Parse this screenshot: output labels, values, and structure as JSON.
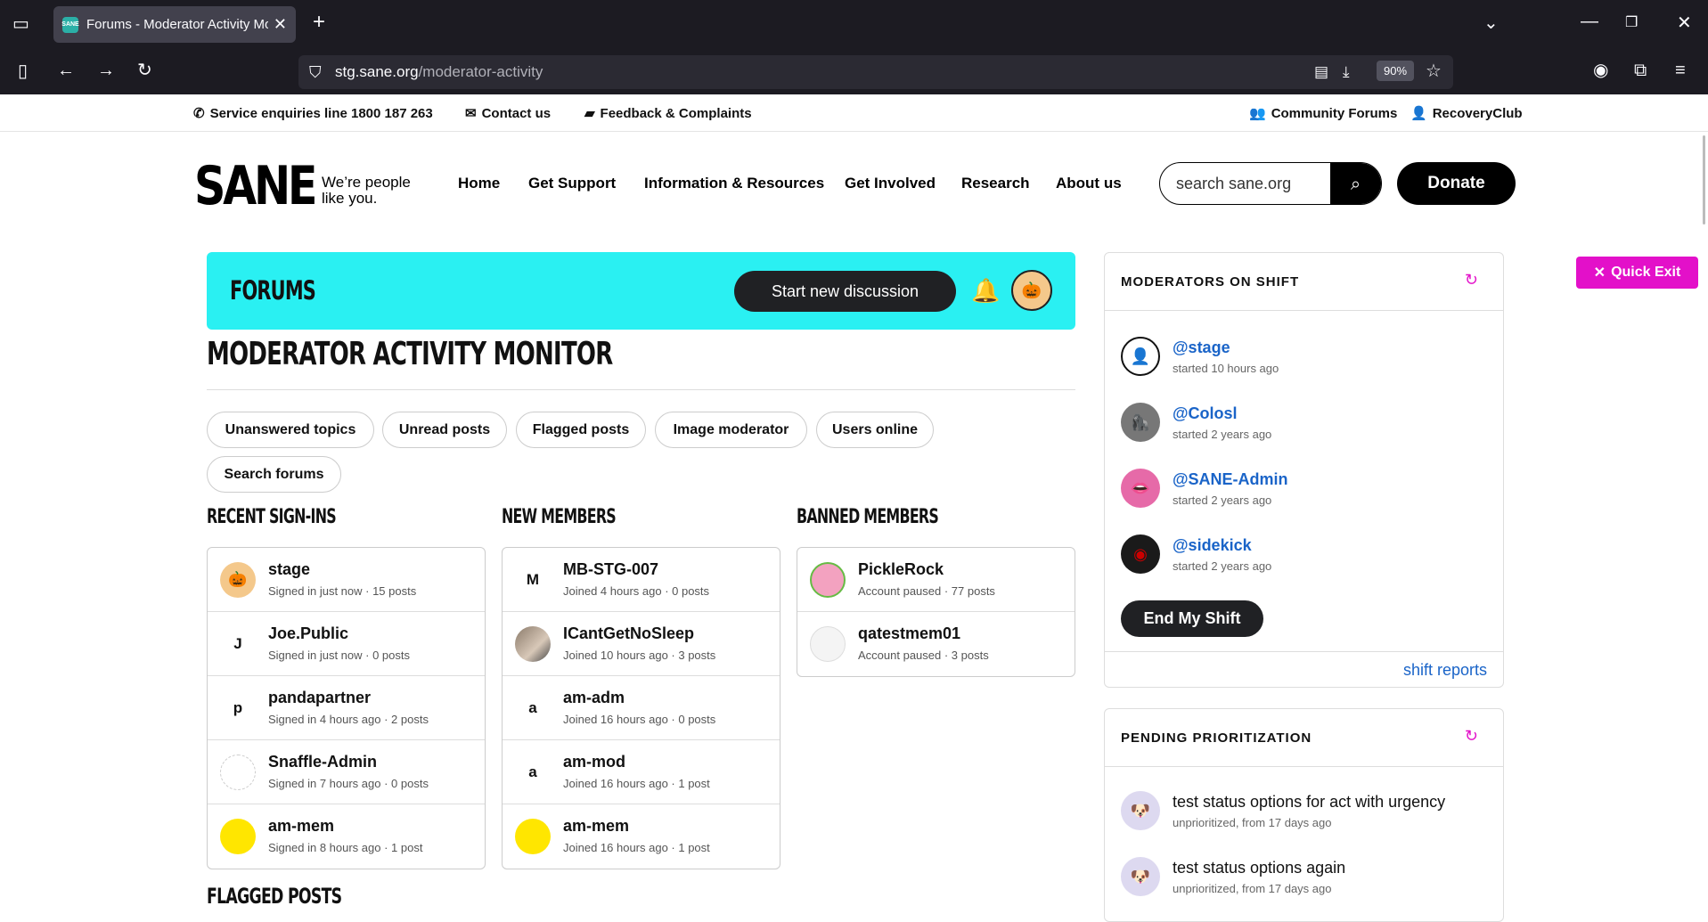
{
  "browser": {
    "tab_title": "Forums - Moderator Activity Mo",
    "tab_favicon": "SANE",
    "url_host": "stg.sane.org",
    "url_path": "/moderator-activity",
    "zoom": "90%"
  },
  "utility_bar": {
    "service": "Service enquiries line 1800 187 263",
    "contact": "Contact us",
    "feedback": "Feedback & Complaints",
    "community": "Community Forums",
    "recovery": "RecoveryClub"
  },
  "header": {
    "logo": "SANE",
    "tagline_1": "We’re people",
    "tagline_2": "like you.",
    "nav": [
      "Home",
      "Get Support",
      "Information & Resources",
      "Get Involved",
      "Research",
      "About us"
    ],
    "search_placeholder": "search sane.org",
    "donate": "Donate"
  },
  "quick_exit": "Quick Exit",
  "banner": {
    "title": "FORUMS",
    "start_discussion": "Start new discussion"
  },
  "page_title": "MODERATOR ACTIVITY MONITOR",
  "filters": [
    "Unanswered topics",
    "Unread posts",
    "Flagged posts",
    "Image moderator",
    "Users online",
    "Search forums"
  ],
  "recent_signins": {
    "heading": "RECENT SIGN-INS",
    "items": [
      {
        "avatar": "🎃",
        "name": "stage",
        "detail": "Signed in just now · 15 posts"
      },
      {
        "avatar": "J",
        "name": "Joe.Public",
        "detail": "Signed in just now · 0 posts"
      },
      {
        "avatar": "p",
        "name": "pandapartner",
        "detail": "Signed in 4 hours ago · 2 posts"
      },
      {
        "avatar": "",
        "name": "Snaffle-Admin",
        "detail": "Signed in 7 hours ago · 0 posts"
      },
      {
        "avatar": "",
        "name": "am-mem",
        "detail": "Signed in 8 hours ago · 1 post"
      }
    ]
  },
  "new_members": {
    "heading": "NEW MEMBERS",
    "items": [
      {
        "avatar": "M",
        "name": "MB-STG-007",
        "detail": "Joined 4 hours ago · 0 posts"
      },
      {
        "avatar": "",
        "name": "ICantGetNoSleep",
        "detail": "Joined 10 hours ago · 3 posts"
      },
      {
        "avatar": "a",
        "name": "am-adm",
        "detail": "Joined 16 hours ago · 0 posts"
      },
      {
        "avatar": "a",
        "name": "am-mod",
        "detail": "Joined 16 hours ago · 1 post"
      },
      {
        "avatar": "",
        "name": "am-mem",
        "detail": "Joined 16 hours ago · 1 post"
      }
    ]
  },
  "banned_members": {
    "heading": "BANNED MEMBERS",
    "items": [
      {
        "avatar": "",
        "name": "PickleRock",
        "detail": "Account paused · 77 posts"
      },
      {
        "avatar": "",
        "name": "qatestmem01",
        "detail": "Account paused · 3 posts"
      }
    ]
  },
  "moderators": {
    "heading": "MODERATORS ON SHIFT",
    "items": [
      {
        "name": "@stage",
        "detail": "started 10 hours ago"
      },
      {
        "name": "@Colosl",
        "detail": "started 2 years ago"
      },
      {
        "name": "@SANE-Admin",
        "detail": "started 2 years ago"
      },
      {
        "name": "@sidekick",
        "detail": "started 2 years ago"
      }
    ],
    "end_shift": "End My Shift",
    "shift_reports": "shift reports"
  },
  "pending": {
    "heading": "PENDING PRIORITIZATION",
    "items": [
      {
        "title": "test status options for act with urgency",
        "detail": "unprioritized, from 17 days ago"
      },
      {
        "title": "test status options again",
        "detail": "unprioritized, from 17 days ago"
      }
    ]
  },
  "flagged_heading": "FLAGGED POSTS",
  "colors": {
    "banner": "#2af0f2",
    "quick_exit": "#e310c9",
    "link": "#1a64c8"
  }
}
